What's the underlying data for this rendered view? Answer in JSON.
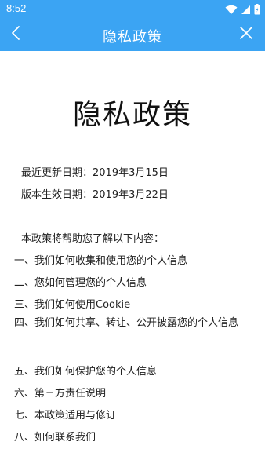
{
  "status_bar": {
    "time": "8:52",
    "icons": [
      "wifi-icon",
      "cellular-signal-icon",
      "battery-icon"
    ]
  },
  "nav": {
    "title": "隐私政策",
    "back_icon": "chevron-left-icon",
    "close_icon": "close-icon"
  },
  "document": {
    "title": "隐私政策",
    "updated": "最近更新日期：2019年3月15日",
    "effective": "版本生效日期：2019年3月22日",
    "intro": "本政策将帮助您了解以下内容：",
    "toc": [
      "一、我们如何收集和使用您的个人信息",
      "二、您如何管理您的个人信息",
      "三、我们如何使用Cookie",
      "四、我们如何共享、转让、公开披露您的个人信息",
      "五、我们如何保护您的个人信息",
      "六、第三方责任说明",
      "七、本政策适用与修订",
      "八、如何联系我们"
    ]
  },
  "colors": {
    "header_bg": "#3BA4F3",
    "header_text": "#FFFFFF",
    "body_text": "#222222"
  }
}
